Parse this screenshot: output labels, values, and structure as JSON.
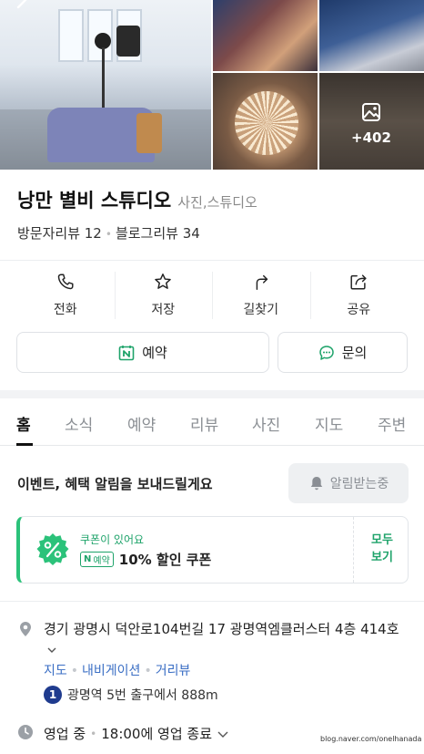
{
  "gallery": {
    "more_count": "+402"
  },
  "place": {
    "name": "낭만 별비 스튜디오",
    "category": "사진,스튜디오",
    "visitor_reviews": "방문자리뷰 12",
    "blog_reviews": "블로그리뷰 34"
  },
  "actions": {
    "call": "전화",
    "save": "저장",
    "directions": "길찾기",
    "share": "공유"
  },
  "buttons": {
    "book": "예약",
    "inquire": "문의"
  },
  "tabs": [
    "홈",
    "소식",
    "예약",
    "리뷰",
    "사진",
    "지도",
    "주변"
  ],
  "alert": {
    "text": "이벤트, 혜택 알림을 보내드릴게요",
    "button": "알림받는중"
  },
  "coupon": {
    "has_coupon": "쿠폰이 있어요",
    "badge": "예약",
    "title": "10% 할인 쿠폰",
    "view_all_line1": "모두",
    "view_all_line2": "보기"
  },
  "info": {
    "address": "경기 광명시 덕안로104번길 17 광명역엠클러스터 4층 414호",
    "link_map": "지도",
    "link_navigation": "내비게이션",
    "link_street_view": "거리뷰",
    "subway_line": "1",
    "subway_text": "광명역 5번 출구에서 888m",
    "hours_status": "영업 중",
    "hours_detail": "18:00에 영업 종료"
  },
  "watermark": "blog.naver.com/onelhanada",
  "colors": {
    "brand_green": "#1ea36a",
    "link_blue": "#3a6ec4",
    "subway_line_1": "#1f3b8e"
  }
}
